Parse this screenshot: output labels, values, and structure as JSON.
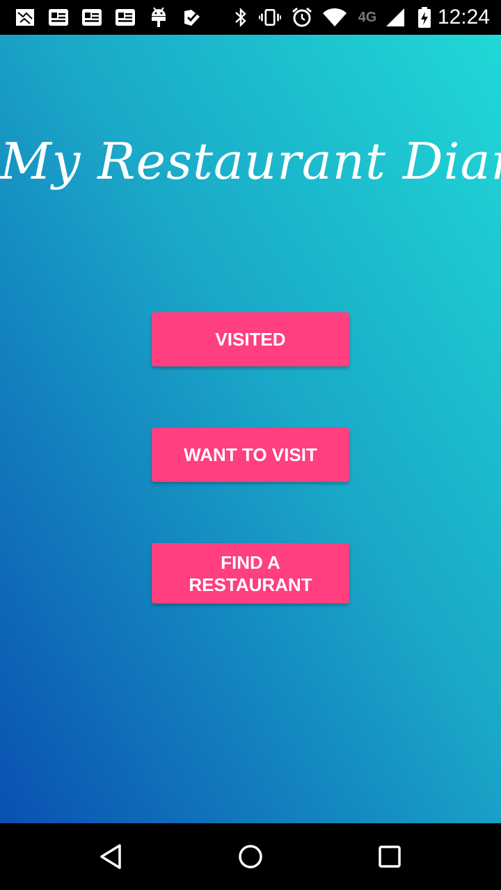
{
  "status_bar": {
    "time": "12:24",
    "network": "4G",
    "icons": [
      "gallery-icon",
      "news-icon",
      "news-icon",
      "news-icon",
      "android-icon",
      "play-store-icon",
      "bluetooth-icon",
      "vibrate-icon",
      "alarm-icon",
      "wifi-icon",
      "signal-icon",
      "battery-charging-icon"
    ]
  },
  "app": {
    "title": "My Restaurant Diary",
    "colors": {
      "gradient_top": "#20d8d6",
      "gradient_bottom": "#0a50b2",
      "button": "#ff3f7f"
    },
    "buttons": {
      "visited": "VISITED",
      "want_to_visit": "WANT TO VISIT",
      "find_restaurant": "FIND A RESTAURANT"
    }
  },
  "nav_bar": {
    "icons": [
      "back-icon",
      "home-icon",
      "recents-icon"
    ]
  }
}
